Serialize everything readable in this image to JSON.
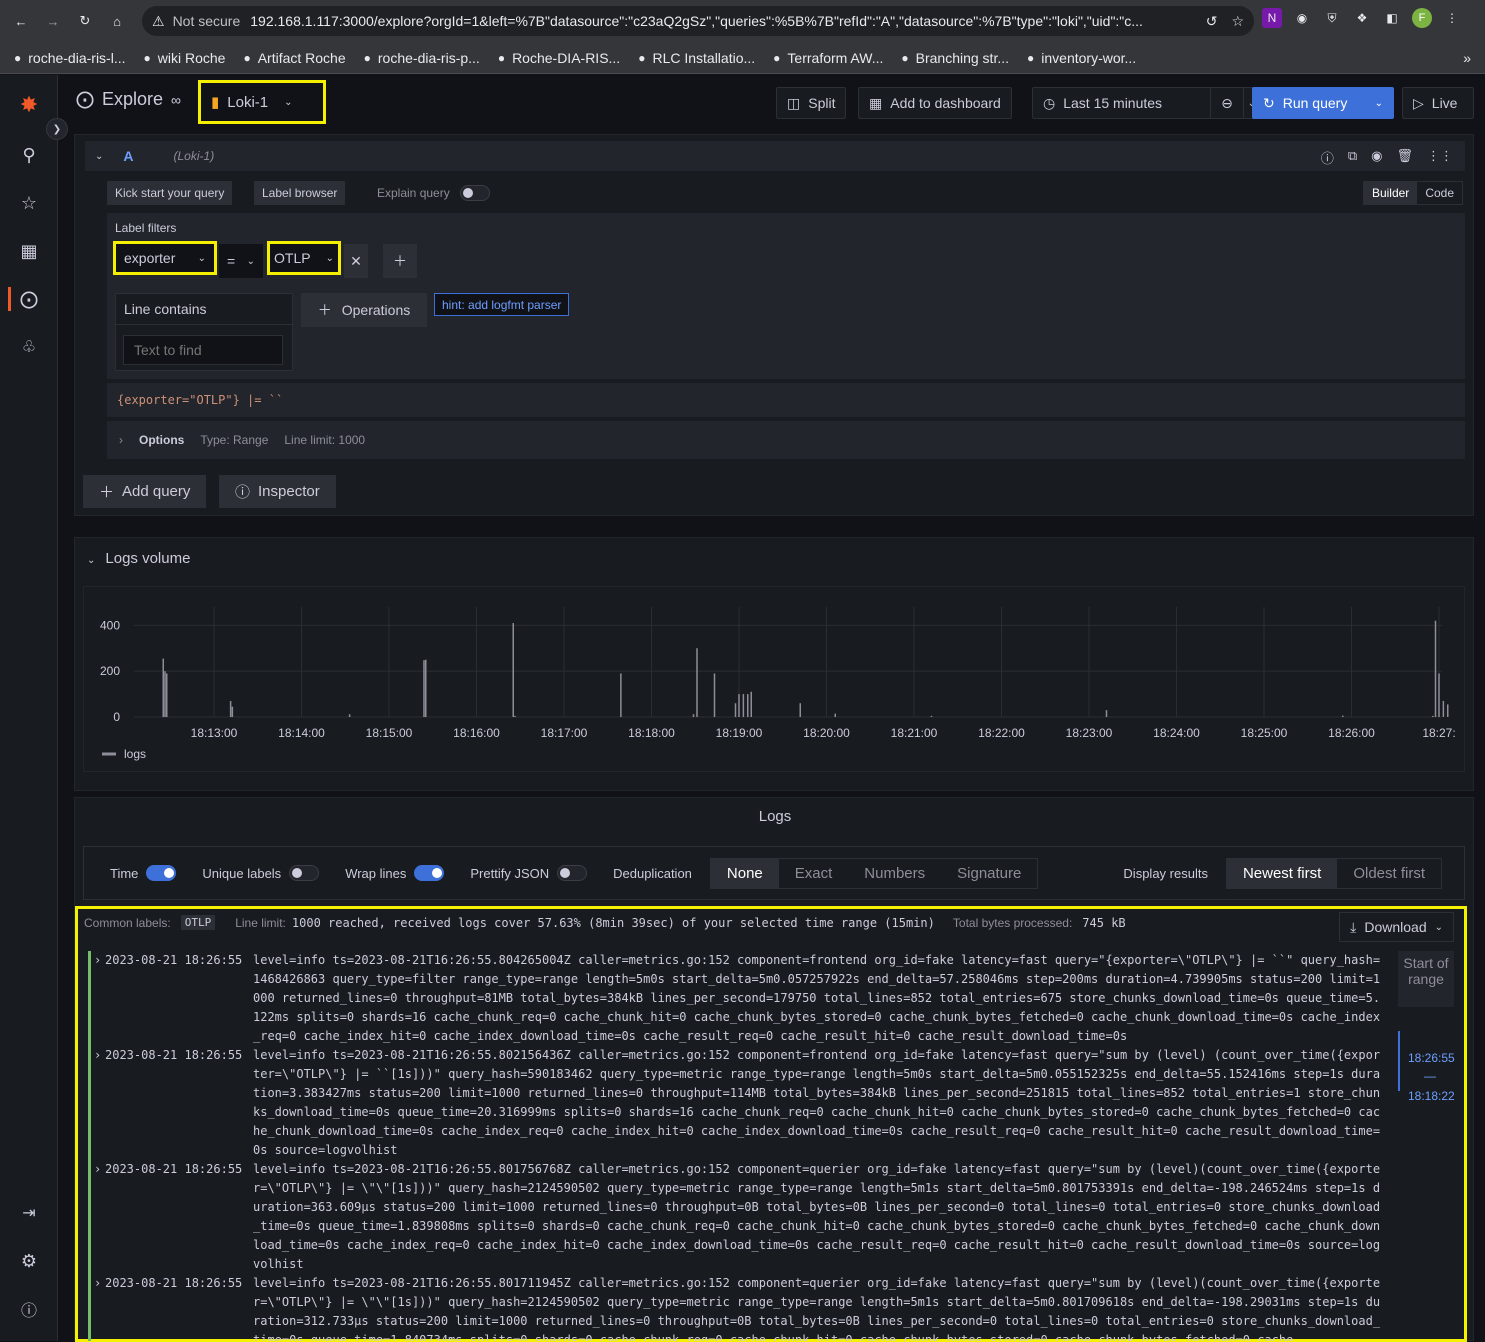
{
  "browser": {
    "not_secure": "Not secure",
    "url": "192.168.1.117:3000/explore?orgId=1&left=%7B\"datasource\":\"c23aQ2gSz\",\"queries\":%5B%7B\"refId\":\"A\",\"datasource\":%7B\"type\":\"loki\",\"uid\":\"c...",
    "avatar": "F",
    "bookmarks": [
      "roche-dia-ris-l...",
      "wiki Roche",
      "Artifact Roche",
      "roche-dia-ris-p...",
      "Roche-DIA-RIS...",
      "RLC Installatio...",
      "Terraform AW...",
      "Branching str...",
      "inventory-wor..."
    ],
    "more": "»"
  },
  "header": {
    "title": "Explore",
    "datasource": "Loki-1",
    "split": "Split",
    "add_dashboard": "Add to dashboard",
    "time_range": "Last 15 minutes",
    "run_query": "Run query",
    "live": "Live"
  },
  "query": {
    "ref": "A",
    "ds_name": "(Loki-1)",
    "kick_start": "Kick start your query",
    "label_browser": "Label browser",
    "explain": "Explain query",
    "builder": "Builder",
    "code": "Code",
    "label_filters": "Label filters",
    "label": "exporter",
    "op": "=",
    "value": "OTLP",
    "line_contains": "Line contains",
    "text_placeholder": "Text to find",
    "operations": "Operations",
    "hint": "hint: add logfmt parser",
    "code_preview": "{exporter=\"OTLP\"} |= ``",
    "options": "Options",
    "type": "Type: Range",
    "line_limit": "Line limit: 1000",
    "add_query": "Add query",
    "inspector": "Inspector"
  },
  "volume": {
    "title": "Logs volume",
    "legend": "logs"
  },
  "chart_data": {
    "type": "bar",
    "title": "",
    "ylim": [
      0,
      480
    ],
    "yticks": [
      0,
      200,
      400
    ],
    "xticks": [
      "18:13:00",
      "18:14:00",
      "18:15:00",
      "18:16:00",
      "18:17:00",
      "18:18:00",
      "18:19:00",
      "18:20:00",
      "18:21:00",
      "18:22:00",
      "18:23:00",
      "18:24:00",
      "18:25:00",
      "18:26:00",
      "18:27:"
    ],
    "series": [
      {
        "name": "logs",
        "color": "#8e8e9a",
        "x_min": [
          -0.58,
          -0.56,
          -0.54,
          0.19,
          0.21,
          1.55,
          2.4,
          2.42,
          3.42,
          3.44,
          4.65,
          5.48,
          5.52,
          5.72,
          5.96,
          6.0,
          6.05,
          6.1,
          6.14,
          6.7,
          7.1,
          8.2,
          10.2,
          12.9,
          13.93,
          13.96,
          14.0,
          14.05,
          14.1
        ],
        "values": [
          255,
          200,
          190,
          70,
          45,
          12,
          248,
          250,
          410,
          5,
          190,
          12,
          300,
          190,
          60,
          100,
          100,
          100,
          110,
          60,
          15,
          5,
          30,
          6,
          5,
          420,
          190,
          70,
          55
        ]
      }
    ]
  },
  "logs": {
    "title": "Logs",
    "time": "Time",
    "unique": "Unique labels",
    "wrap": "Wrap lines",
    "prettify": "Prettify JSON",
    "dedup": "Deduplication",
    "dedup_opts": [
      "None",
      "Exact",
      "Numbers",
      "Signature"
    ],
    "display": "Display results",
    "newest": "Newest first",
    "oldest": "Oldest first",
    "common_labels": "Common labels:",
    "common_value": "OTLP",
    "limit_text": "Line limit:",
    "limit_mono": "1000 reached, received logs cover 57.63% (8min 39sec) of your selected time range (15min)",
    "bytes": "Total bytes processed:",
    "bytes_val": "745 kB",
    "download": "Download",
    "start_range": "Start of range",
    "range_top": "18:26:55",
    "range_dash": "—",
    "range_bottom": "18:18:22",
    "rows": [
      {
        "ts": "2023-08-21 18:26:55",
        "msg": "level=info ts=2023-08-21T16:26:55.804265004Z caller=metrics.go:152 component=frontend org_id=fake latency=fast query=\"{exporter=\\\"OTLP\\\"} |= ``\" query_hash=1468426863 query_type=filter range_type=range length=5m0s start_delta=5m0.057257922s end_delta=57.258046ms step=200ms duration=4.739905ms status=200 limit=1000 returned_lines=0 throughput=81MB total_bytes=384kB lines_per_second=179750 total_lines=852 total_entries=675 store_chunks_download_time=0s queue_time=5.122ms splits=0 shards=16 cache_chunk_req=0 cache_chunk_hit=0 cache_chunk_bytes_stored=0 cache_chunk_bytes_fetched=0 cache_chunk_download_time=0s cache_index_req=0 cache_index_hit=0 cache_index_download_time=0s cache_result_req=0 cache_result_hit=0 cache_result_download_time=0s"
      },
      {
        "ts": "2023-08-21 18:26:55",
        "msg": "level=info ts=2023-08-21T16:26:55.802156436Z caller=metrics.go:152 component=frontend org_id=fake latency=fast query=\"sum by (level) (count_over_time({exporter=\\\"OTLP\\\"} |= ``[1s]))\" query_hash=590183462 query_type=metric range_type=range length=5m0s start_delta=5m0.055152325s end_delta=55.152416ms step=1s duration=3.383427ms status=200 limit=1000 returned_lines=0 throughput=114MB total_bytes=384kB lines_per_second=251815 total_lines=852 total_entries=1 store_chunks_download_time=0s queue_time=20.316999ms splits=0 shards=16 cache_chunk_req=0 cache_chunk_hit=0 cache_chunk_bytes_stored=0 cache_chunk_bytes_fetched=0 cache_chunk_download_time=0s cache_index_req=0 cache_index_hit=0 cache_index_download_time=0s cache_result_req=0 cache_result_hit=0 cache_result_download_time=0s source=logvolhist"
      },
      {
        "ts": "2023-08-21 18:26:55",
        "msg": "level=info ts=2023-08-21T16:26:55.801756768Z caller=metrics.go:152 component=querier org_id=fake latency=fast query=\"sum by (level)(count_over_time({exporter=\\\"OTLP\\\"} |= \\\"\\\"[1s]))\" query_hash=2124590502 query_type=metric range_type=range length=5m1s start_delta=5m0.801753391s end_delta=-198.246524ms step=1s duration=363.609µs status=200 limit=1000 returned_lines=0 throughput=0B total_bytes=0B lines_per_second=0 total_lines=0 total_entries=0 store_chunks_download_time=0s queue_time=1.839808ms splits=0 shards=0 cache_chunk_req=0 cache_chunk_hit=0 cache_chunk_bytes_stored=0 cache_chunk_bytes_fetched=0 cache_chunk_download_time=0s cache_index_req=0 cache_index_hit=0 cache_index_download_time=0s cache_result_req=0 cache_result_hit=0 cache_result_download_time=0s source=logvolhist"
      },
      {
        "ts": "2023-08-21 18:26:55",
        "msg": "level=info ts=2023-08-21T16:26:55.801711945Z caller=metrics.go:152 component=querier org_id=fake latency=fast query=\"sum by (level)(count_over_time({exporter=\\\"OTLP\\\"} |= \\\"\\\"[1s]))\" query_hash=2124590502 query_type=metric range_type=range length=5m1s start_delta=5m0.801709618s end_delta=-198.29031ms step=1s duration=312.733µs status=200 limit=1000 returned_lines=0 throughput=0B total_bytes=0B lines_per_second=0 total_lines=0 total_entries=0 store_chunks_download_time=0s queue_time=1.840734ms splits=0 shards=0 cache_chunk_req=0 cache_chunk_hit=0 cache_chunk_bytes_stored=0 cache_chunk_bytes_fetched=0 cache"
      }
    ]
  }
}
